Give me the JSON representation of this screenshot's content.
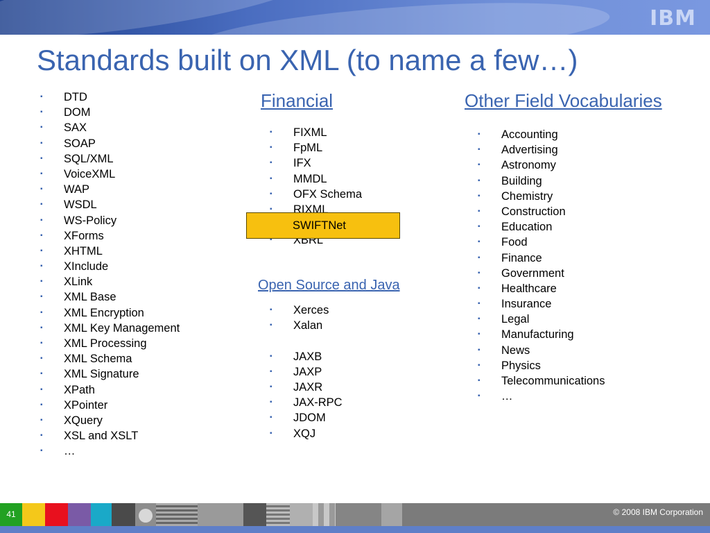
{
  "title": "Standards built on XML (to name a few…)",
  "logo": "IBM",
  "left_list": [
    "DTD",
    "DOM",
    "SAX",
    "SOAP",
    "SQL/XML",
    "VoiceXML",
    "WAP",
    "WSDL",
    "WS-Policy",
    "XForms",
    "XHTML",
    "XInclude",
    "XLink",
    "XML Base",
    "XML Encryption",
    "XML Key Management",
    "XML Processing",
    "XML Schema",
    "XML Signature",
    "XPath",
    "XPointer",
    "XQuery",
    "XSL and XSLT",
    "…"
  ],
  "financial": {
    "heading": "Financial",
    "items": [
      "FIXML",
      "FpML",
      "IFX",
      "MMDL",
      "OFX Schema",
      "RIXML",
      "SWIFTNet",
      "XBRL"
    ],
    "highlight": "SWIFTNet"
  },
  "open_source": {
    "heading": "Open Source and Java",
    "items": [
      "Xerces",
      "Xalan",
      "",
      "JAXB",
      "JAXP",
      "JAXR",
      "JAX-RPC",
      "JDOM",
      "XQJ"
    ]
  },
  "other": {
    "heading": "Other Field Vocabularies",
    "items": [
      "Accounting",
      "Advertising",
      "Astronomy",
      "Building",
      "Chemistry",
      "Construction",
      "Education",
      "Food",
      "Finance",
      "Government",
      "Healthcare",
      "Insurance",
      "Legal",
      "Manufacturing",
      "News",
      "Physics",
      "Telecommunications",
      "…"
    ]
  },
  "footer": {
    "page_number": "41",
    "copyright": "© 2008 IBM Corporation"
  },
  "colors": {
    "accent": "#3a64b0",
    "highlight": "#f7c00f",
    "page_badge": "#22a122"
  }
}
